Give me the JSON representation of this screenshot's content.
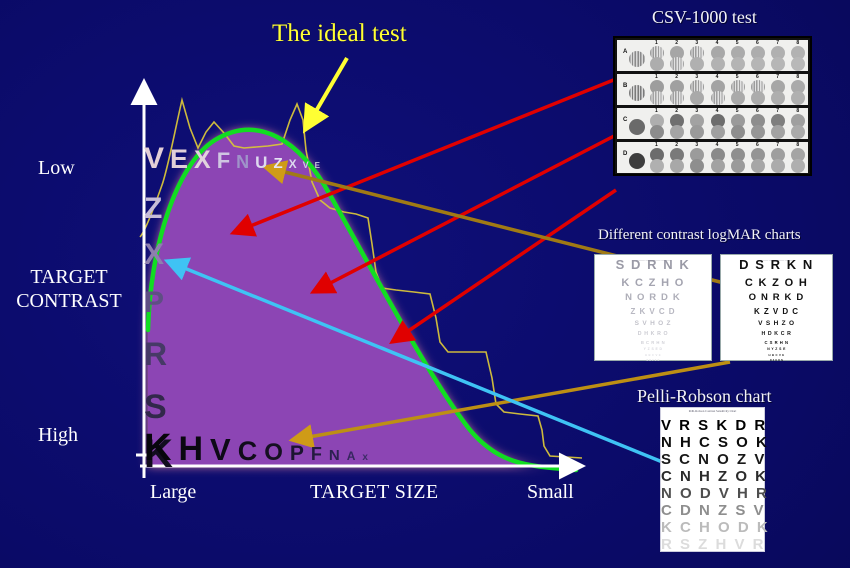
{
  "slide": {
    "background_color": "#0b0b6b",
    "title_annotation": "The ideal test"
  },
  "axes": {
    "y_label_top": "Low",
    "y_label_bottom": "High",
    "y_title_line1": "TARGET",
    "y_title_line2": "CONTRAST",
    "x_label_left": "Large",
    "x_label_right": "Small",
    "x_title": "TARGET SIZE",
    "axis_color": "#ffffff"
  },
  "plot": {
    "area_fill": "#8c45b4",
    "ideal_curve_color": "#11dd22",
    "measured_curve_color": "#d8c43a",
    "glow_color": "#ff9fb0"
  },
  "letter_chart": {
    "top_row": [
      "V",
      "E",
      "X",
      "F",
      "N",
      "U",
      "Z",
      "X",
      "V",
      "E"
    ],
    "left_column": [
      "V",
      "Z",
      "X",
      "P",
      "R",
      "S",
      "K"
    ],
    "bottom_row": [
      "K",
      "H",
      "V",
      "C",
      "O",
      "P",
      "F",
      "N",
      "A",
      "x"
    ]
  },
  "connectors": [
    {
      "name": "csv-row-a",
      "color": "#e00000"
    },
    {
      "name": "csv-row-c",
      "color": "#e00000"
    },
    {
      "name": "csv-row-d",
      "color": "#e00000"
    },
    {
      "name": "logmar-link",
      "color": "#a07a14"
    },
    {
      "name": "pelli-link",
      "color": "#a07a14"
    },
    {
      "name": "pelli-arrow",
      "color": "#3fc3f4"
    },
    {
      "name": "ideal-test-arrow",
      "color": "#ffff33"
    }
  ],
  "csv_test": {
    "caption": "CSV-1000 test",
    "row_labels": [
      "A",
      "B",
      "C",
      "D"
    ],
    "column_numbers": [
      "1",
      "2",
      "3",
      "4",
      "5",
      "6",
      "7",
      "8"
    ]
  },
  "logmar": {
    "caption": "Different contrast logMAR charts",
    "low_contrast": {
      "lines": [
        "S D R N K",
        "K C Z H O",
        "N O R D K",
        "Z K V C D",
        "S V H O Z",
        "D H K R O",
        "B C R H N",
        "Y Z S E D",
        "H B C V E",
        "N R Z K D"
      ]
    },
    "high_contrast": {
      "lines": [
        "D S R K N",
        "C K Z O H",
        "O N R K D",
        "K Z V D C",
        "V S H Z O",
        "H D K C R",
        "C S R H N",
        "N Y Z S E",
        "H B C V E",
        "R Z K D N"
      ]
    }
  },
  "pelli_robson": {
    "caption": "Pelli-Robson chart",
    "rows": [
      "V R S K D R",
      "N H C S O K",
      "S C N O Z V",
      "C N H Z O K",
      "N O D V H R",
      "C D N Z S V",
      "K C H O D K",
      "R S Z H V R"
    ]
  }
}
